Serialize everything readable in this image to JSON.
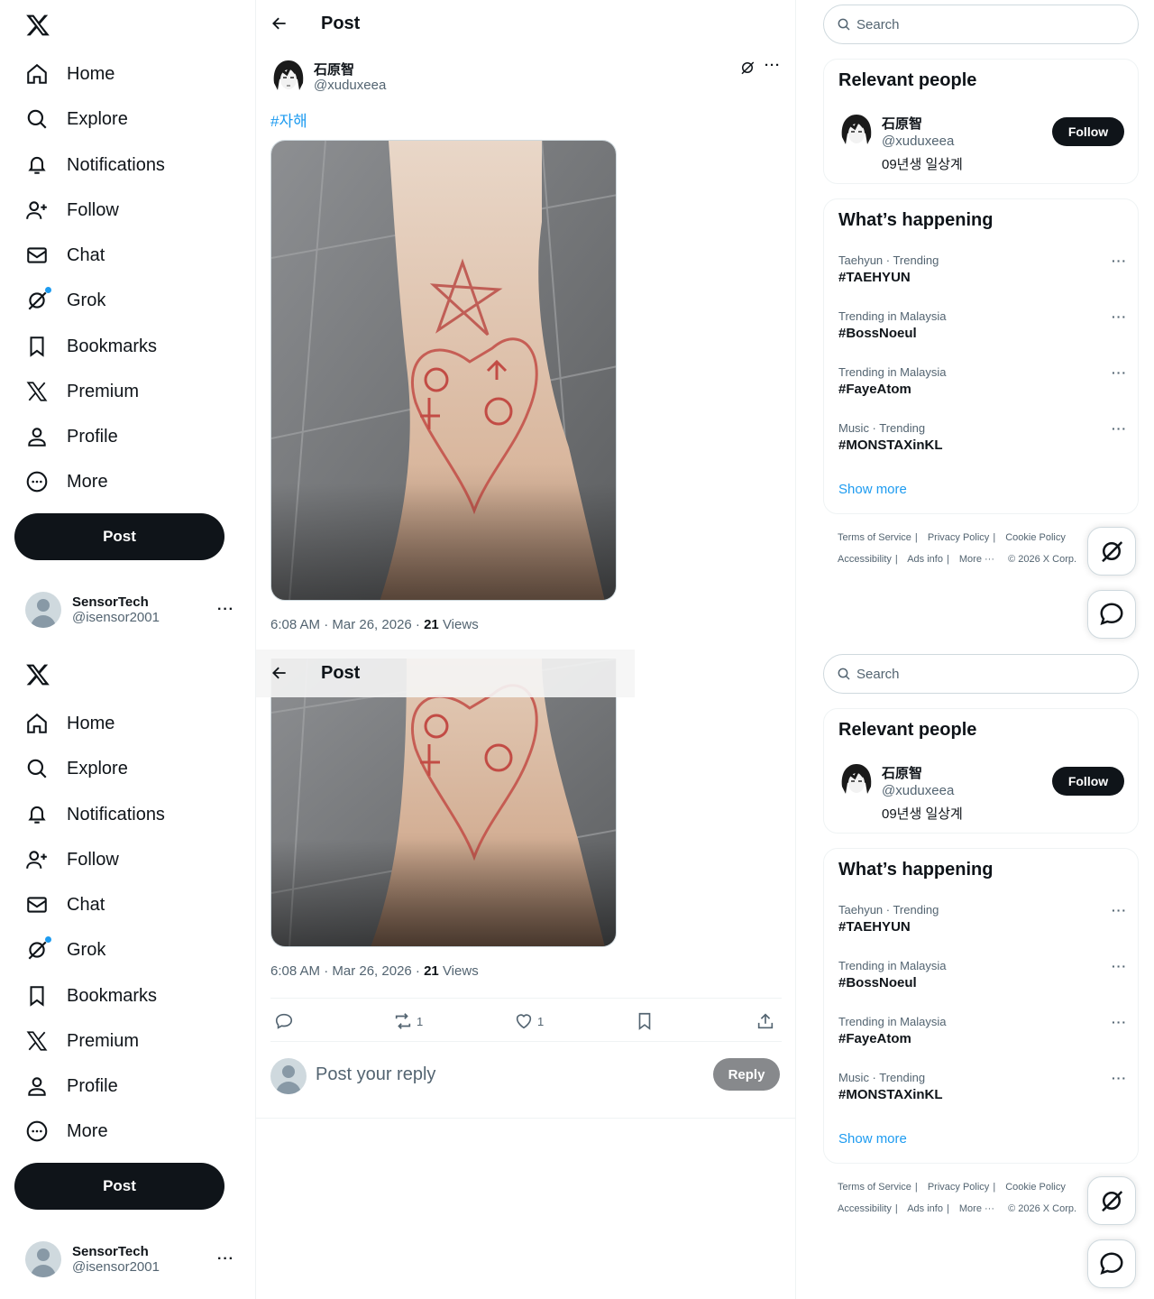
{
  "nav": {
    "items": [
      {
        "label": "Home",
        "icon": "home-icon"
      },
      {
        "label": "Explore",
        "icon": "search-icon"
      },
      {
        "label": "Notifications",
        "icon": "bell-icon"
      },
      {
        "label": "Follow",
        "icon": "add-person-icon"
      },
      {
        "label": "Chat",
        "icon": "mail-icon"
      },
      {
        "label": "Grok",
        "icon": "grok-icon"
      },
      {
        "label": "Bookmarks",
        "icon": "bookmark-icon"
      },
      {
        "label": "Premium",
        "icon": "x-logo-icon"
      },
      {
        "label": "Profile",
        "icon": "person-icon"
      },
      {
        "label": "More",
        "icon": "more-circle-icon"
      }
    ],
    "post_label": "Post"
  },
  "account": {
    "name": "SensorTech",
    "handle": "@isensor2001"
  },
  "header": {
    "title": "Post"
  },
  "tweet": {
    "author_name": "石原智",
    "author_handle": "@xuduxeea",
    "hashtag": "#자해",
    "time": "6:08 AM · Mar 26, 2026 · ",
    "views_count": "21",
    "views_label": " Views",
    "retweets": "1",
    "likes": "1"
  },
  "reply": {
    "placeholder": "Post your reply",
    "button": "Reply"
  },
  "search": {
    "placeholder": "Search"
  },
  "relevant": {
    "title": "Relevant people",
    "name": "石原智",
    "handle": "@xuduxeea",
    "bio": "09년생 일상계",
    "follow": "Follow"
  },
  "happening": {
    "title": "What’s happening",
    "trends": [
      {
        "meta": "Taehyun · Trending",
        "name": "#TAEHYUN"
      },
      {
        "meta": "Trending in Malaysia",
        "name": "#BossNoeul"
      },
      {
        "meta": "Trending in Malaysia",
        "name": "#FayeAtom"
      },
      {
        "meta": "Music · Trending",
        "name": "#MONSTAXinKL"
      }
    ],
    "show_more": "Show more"
  },
  "footer": {
    "links": [
      "Terms of Service",
      "Privacy Policy",
      "Cookie Policy",
      "Accessibility",
      "Ads info",
      "More ···",
      "© 2026 X Corp."
    ]
  },
  "colors": {
    "accent": "#1d9bf0",
    "dark": "#0f1419",
    "muted": "#536471"
  }
}
